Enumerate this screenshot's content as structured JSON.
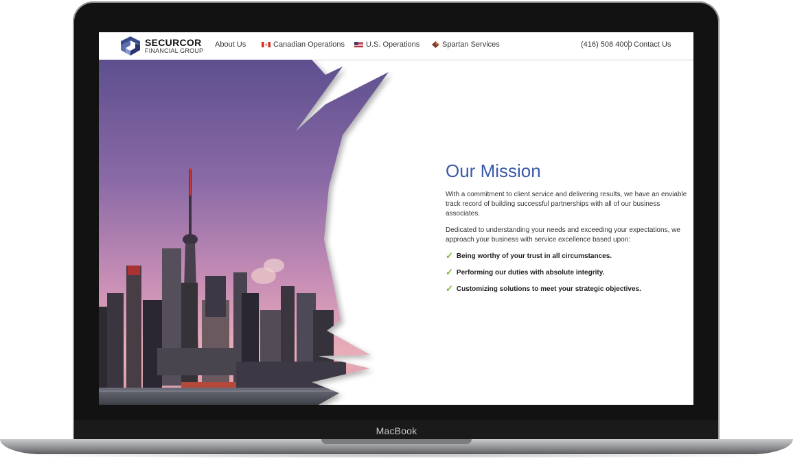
{
  "device": {
    "label": "MacBook"
  },
  "nav": {
    "logo_name": "SECURCOR",
    "logo_sub": "FINANCIAL GROUP",
    "items": [
      {
        "label": "About Us"
      },
      {
        "label": "Canadian Operations"
      },
      {
        "label": "U.S. Operations"
      },
      {
        "label": "Spartan Services"
      }
    ],
    "phone": "(416) 508 4000",
    "contact": "Contact Us"
  },
  "mission": {
    "title": "Our Mission",
    "paragraph1": "With a commitment to client service and delivering results, we have an enviable track record of building successful partnerships with all of our business associates.",
    "paragraph2": "Dedicated to understanding your needs and exceeding your expectations, we approach your business with service excellence based upon:",
    "bullets": [
      "Being worthy of your trust in all circumstances.",
      "Performing our duties with absolute integrity.",
      "Customizing solutions to meet your strategic objectives."
    ]
  },
  "colors": {
    "accent": "#3a5aa8",
    "check": "#7ab72f",
    "sky_top": "#6e5a9c",
    "sky_bottom": "#e0a3b6"
  }
}
